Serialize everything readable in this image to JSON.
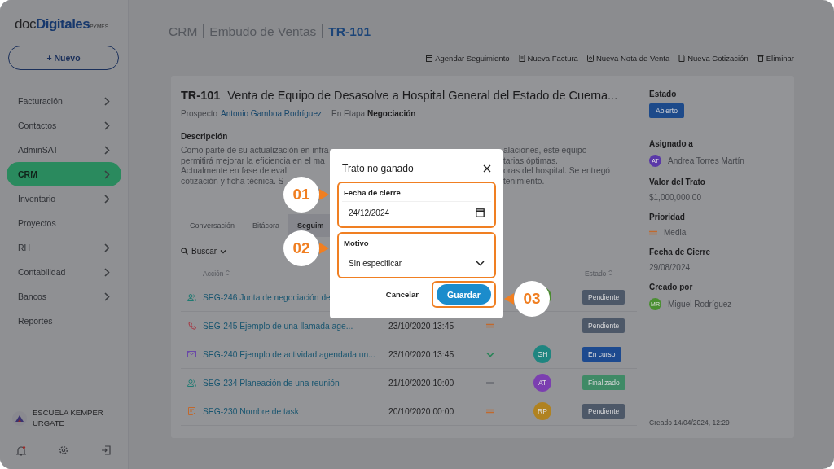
{
  "brand": {
    "name_light": "doc",
    "name_bold": "Digitales",
    "suffix": "PYMES"
  },
  "new_button": {
    "label": "+ Nuevo"
  },
  "sidebar": {
    "items": [
      {
        "label": "Facturación",
        "has_children": true,
        "selected": false
      },
      {
        "label": "Contactos",
        "has_children": true,
        "selected": false
      },
      {
        "label": "AdminSAT",
        "has_children": true,
        "selected": false
      },
      {
        "label": "CRM",
        "has_children": true,
        "selected": true
      },
      {
        "label": "Inventario",
        "has_children": true,
        "selected": false
      },
      {
        "label": "Proyectos",
        "has_children": false,
        "selected": false
      },
      {
        "label": "RH",
        "has_children": true,
        "selected": false
      },
      {
        "label": "Contabilidad",
        "has_children": true,
        "selected": false
      },
      {
        "label": "Bancos",
        "has_children": true,
        "selected": false
      },
      {
        "label": "Reportes",
        "has_children": false,
        "selected": false
      }
    ],
    "organization": "ESCUELA KEMPER URGATE"
  },
  "breadcrumb": [
    "CRM",
    "Embudo de Ventas",
    "TR-101"
  ],
  "actions": [
    {
      "label": "Agendar Seguimiento",
      "kind": "calendar"
    },
    {
      "label": "Nueva Factura",
      "kind": "invoice"
    },
    {
      "label": "Nueva Nota de Venta",
      "kind": "note"
    },
    {
      "label": "Nueva Cotización",
      "kind": "document"
    },
    {
      "label": "Eliminar",
      "kind": "delete"
    }
  ],
  "deal": {
    "code": "TR-101",
    "title": "Venta de Equipo de Desasolve a Hospital General del Estado de Cuerna...",
    "prospect_label": "Prospecto",
    "prospect": "Antonio Gamboa Rodríguez",
    "stage": "En Etapa **Negociación**",
    "description_label": "Descripción",
    "description_lines": [
      {
        "left": "Como parte de su actualización en infra",
        "right": "alaciones, este equipo"
      },
      {
        "left": "permitirá mejorar la eficiencia en el ma",
        "right": "tarias óptimas."
      },
      {
        "left": "Actualmente en fase de eval",
        "right": "oras del hospital. Se entregó"
      },
      {
        "left": "cotización y ficha técnica. S",
        "right": "tenimiento."
      }
    ]
  },
  "tabs": [
    {
      "label": "Conversación",
      "selected": false
    },
    {
      "label": "Bitácora",
      "selected": false
    },
    {
      "label": "Seguim",
      "selected": true
    }
  ],
  "search": {
    "label": "Buscar"
  },
  "table": {
    "columns": [
      {
        "label": "Acción"
      },
      {
        "label": "Estado"
      }
    ],
    "rows": [
      {
        "kind": "meeting",
        "title": "SEG-246 Junta de negociación de",
        "assignee": {
          "color": "#4a8a30"
        },
        "status": {
          "label": "Pendiente",
          "color": "#4d5868"
        }
      },
      {
        "kind": "call",
        "title": "SEG-245 Ejemplo de una llamada age...",
        "date": "23/10/2020 13:45",
        "priority": {
          "kind": "medium"
        },
        "assignee": {
          "text": "-"
        },
        "status": {
          "label": "Pendiente",
          "color": "#4d5868"
        }
      },
      {
        "kind": "email",
        "title": "SEG-240 Ejemplo de actividad agendada un...",
        "date": "23/10/2020 13:45",
        "priority": {
          "kind": "low"
        },
        "assignee": {
          "initials": "GH",
          "color": "#1f8580"
        },
        "status": {
          "label": "En curso",
          "color": "#1d4a8f"
        }
      },
      {
        "kind": "meeting",
        "title": "SEG-234 Planeación de una reunión",
        "date": "21/10/2020 10:00",
        "priority": {
          "kind": "none"
        },
        "assignee": {
          "initials": "AT",
          "color": "#7b3fb0"
        },
        "status": {
          "label": "Finalizado",
          "color": "#3f8a66"
        }
      },
      {
        "kind": "task",
        "title": "SEG-230 Nombre de task",
        "date": "20/10/2020 00:00",
        "priority": {
          "kind": "medium"
        },
        "assignee": {
          "initials": "RP",
          "color": "#b08220"
        },
        "status": {
          "label": "Pendiente",
          "color": "#4d5868"
        }
      }
    ]
  },
  "details": {
    "status_label": "Estado",
    "status": {
      "label": "Abierto",
      "color": "#1d4a8a"
    },
    "assigned_label": "Asignado a",
    "assigned": {
      "initials": "AT",
      "name": "Andrea Torres Martín",
      "color": "#5a38a8"
    },
    "value_label": "Valor del Trato",
    "value": "$1,000,000.00",
    "priority_label": "Prioridad",
    "priority": {
      "kind": "medium",
      "label": "Media"
    },
    "close_label": "Fecha de Cierre",
    "close_date": "29/08/2024",
    "created_by_label": "Creado por",
    "created_by": {
      "initials": "MR",
      "name": "Miguel Rodríguez",
      "color": "#4a8f32"
    },
    "created": "Creado 14/04/2024, 12:29"
  },
  "dialog": {
    "title": "Trato no ganado",
    "date_label": "Fecha de cierre",
    "date_value": "24/12/2024",
    "reason_label": "Motivo",
    "reason_value": "Sin especificar",
    "cancel": "Cancelar",
    "save": "Guardar"
  },
  "callouts": [
    "01",
    "02",
    "03"
  ]
}
